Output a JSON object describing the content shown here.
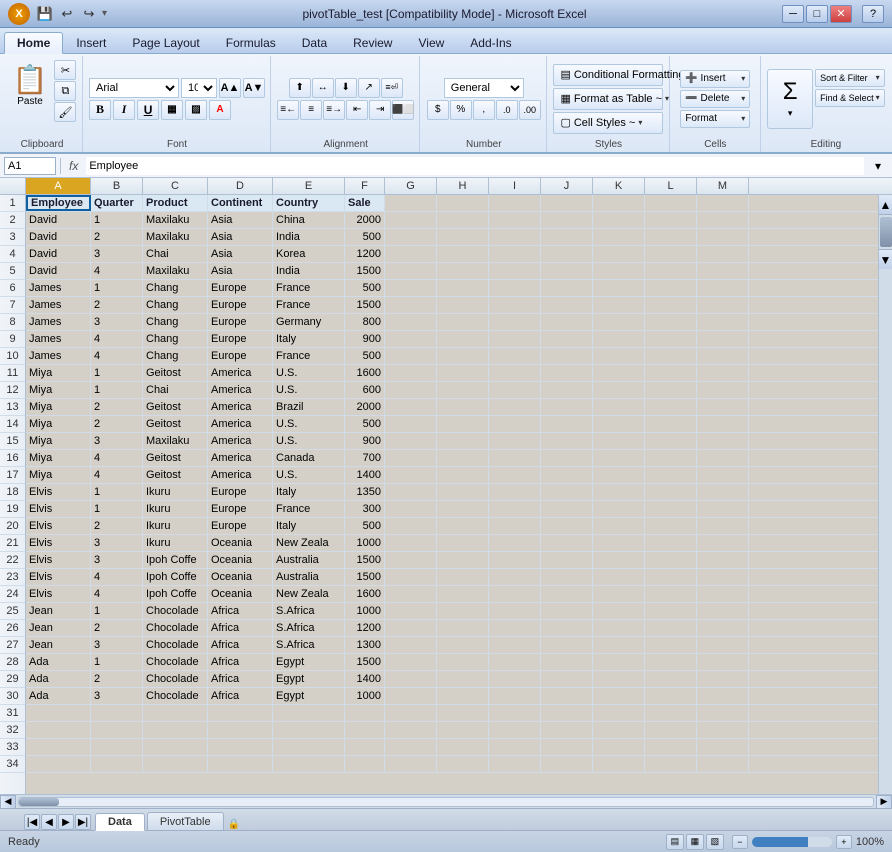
{
  "titleBar": {
    "title": "pivotTable_test [Compatibility Mode] - Microsoft Excel",
    "quickAccess": [
      "💾",
      "↩",
      "↪"
    ],
    "windowControls": [
      "─",
      "□",
      "✕"
    ]
  },
  "ribbon": {
    "tabs": [
      "Home",
      "Insert",
      "Page Layout",
      "Formulas",
      "Data",
      "Review",
      "View",
      "Add-Ins"
    ],
    "activeTab": "Home",
    "groups": {
      "clipboard": {
        "label": "Clipboard",
        "paste": "Paste"
      },
      "font": {
        "label": "Font",
        "name": "Arial",
        "size": "10"
      },
      "alignment": {
        "label": "Alignment"
      },
      "number": {
        "label": "Number",
        "format": "General"
      },
      "styles": {
        "label": "Styles",
        "condFormat": "Conditional Formatting ~",
        "formatTable": "Format as Table ~",
        "cellStyles": "Cell Styles ~"
      },
      "cells": {
        "label": "Cells",
        "insert": "Insert",
        "delete": "Delete",
        "format": "Format"
      },
      "editing": {
        "label": "Editing",
        "sum": "Σ",
        "sortFilter": "Sort & Filter ~",
        "findSelect": "Find & Select ~"
      }
    }
  },
  "formulaBar": {
    "cellRef": "A1",
    "fx": "fx",
    "formula": "Employee"
  },
  "columns": [
    {
      "name": "A",
      "width": 65
    },
    {
      "name": "B",
      "width": 52
    },
    {
      "name": "C",
      "width": 65
    },
    {
      "name": "D",
      "width": 65
    },
    {
      "name": "E",
      "width": 72
    },
    {
      "name": "F",
      "width": 40
    },
    {
      "name": "G",
      "width": 52
    },
    {
      "name": "H",
      "width": 52
    },
    {
      "name": "I",
      "width": 52
    },
    {
      "name": "J",
      "width": 52
    },
    {
      "name": "K",
      "width": 52
    },
    {
      "name": "L",
      "width": 52
    },
    {
      "name": "M",
      "width": 52
    }
  ],
  "rows": [
    [
      1,
      "Employee",
      "Quarter",
      "Product",
      "Continent",
      "Country",
      "Sale",
      "",
      "",
      "",
      "",
      "",
      "",
      ""
    ],
    [
      2,
      "David",
      "1",
      "Maxilaku",
      "Asia",
      "China",
      "2000",
      "",
      "",
      "",
      "",
      "",
      "",
      ""
    ],
    [
      3,
      "David",
      "2",
      "Maxilaku",
      "Asia",
      "India",
      "500",
      "",
      "",
      "",
      "",
      "",
      "",
      ""
    ],
    [
      4,
      "David",
      "3",
      "Chai",
      "Asia",
      "Korea",
      "1200",
      "",
      "",
      "",
      "",
      "",
      "",
      ""
    ],
    [
      5,
      "David",
      "4",
      "Maxilaku",
      "Asia",
      "India",
      "1500",
      "",
      "",
      "",
      "",
      "",
      "",
      ""
    ],
    [
      6,
      "James",
      "1",
      "Chang",
      "Europe",
      "France",
      "500",
      "",
      "",
      "",
      "",
      "",
      "",
      ""
    ],
    [
      7,
      "James",
      "2",
      "Chang",
      "Europe",
      "France",
      "1500",
      "",
      "",
      "",
      "",
      "",
      "",
      ""
    ],
    [
      8,
      "James",
      "3",
      "Chang",
      "Europe",
      "Germany",
      "800",
      "",
      "",
      "",
      "",
      "",
      "",
      ""
    ],
    [
      9,
      "James",
      "4",
      "Chang",
      "Europe",
      "Italy",
      "900",
      "",
      "",
      "",
      "",
      "",
      "",
      ""
    ],
    [
      10,
      "James",
      "4",
      "Chang",
      "Europe",
      "France",
      "500",
      "",
      "",
      "",
      "",
      "",
      "",
      ""
    ],
    [
      11,
      "Miya",
      "1",
      "Geitost",
      "America",
      "U.S.",
      "1600",
      "",
      "",
      "",
      "",
      "",
      "",
      ""
    ],
    [
      12,
      "Miya",
      "1",
      "Chai",
      "America",
      "U.S.",
      "600",
      "",
      "",
      "",
      "",
      "",
      "",
      ""
    ],
    [
      13,
      "Miya",
      "2",
      "Geitost",
      "America",
      "Brazil",
      "2000",
      "",
      "",
      "",
      "",
      "",
      "",
      ""
    ],
    [
      14,
      "Miya",
      "2",
      "Geitost",
      "America",
      "U.S.",
      "500",
      "",
      "",
      "",
      "",
      "",
      "",
      ""
    ],
    [
      15,
      "Miya",
      "3",
      "Maxilaku",
      "America",
      "U.S.",
      "900",
      "",
      "",
      "",
      "",
      "",
      "",
      ""
    ],
    [
      16,
      "Miya",
      "4",
      "Geitost",
      "America",
      "Canada",
      "700",
      "",
      "",
      "",
      "",
      "",
      "",
      ""
    ],
    [
      17,
      "Miya",
      "4",
      "Geitost",
      "America",
      "U.S.",
      "1400",
      "",
      "",
      "",
      "",
      "",
      "",
      ""
    ],
    [
      18,
      "Elvis",
      "1",
      "Ikuru",
      "Europe",
      "Italy",
      "1350",
      "",
      "",
      "",
      "",
      "",
      "",
      ""
    ],
    [
      19,
      "Elvis",
      "1",
      "Ikuru",
      "Europe",
      "France",
      "300",
      "",
      "",
      "",
      "",
      "",
      "",
      ""
    ],
    [
      20,
      "Elvis",
      "2",
      "Ikuru",
      "Europe",
      "Italy",
      "500",
      "",
      "",
      "",
      "",
      "",
      "",
      ""
    ],
    [
      21,
      "Elvis",
      "3",
      "Ikuru",
      "Oceania",
      "New Zeala",
      "1000",
      "",
      "",
      "",
      "",
      "",
      "",
      ""
    ],
    [
      22,
      "Elvis",
      "3",
      "Ipoh Coffe",
      "Oceania",
      "Australia",
      "1500",
      "",
      "",
      "",
      "",
      "",
      "",
      ""
    ],
    [
      23,
      "Elvis",
      "4",
      "Ipoh Coffe",
      "Oceania",
      "Australia",
      "1500",
      "",
      "",
      "",
      "",
      "",
      "",
      ""
    ],
    [
      24,
      "Elvis",
      "4",
      "Ipoh Coffe",
      "Oceania",
      "New Zeala",
      "1600",
      "",
      "",
      "",
      "",
      "",
      "",
      ""
    ],
    [
      25,
      "Jean",
      "1",
      "Chocolade",
      "Africa",
      "S.Africa",
      "1000",
      "",
      "",
      "",
      "",
      "",
      "",
      ""
    ],
    [
      26,
      "Jean",
      "2",
      "Chocolade",
      "Africa",
      "S.Africa",
      "1200",
      "",
      "",
      "",
      "",
      "",
      "",
      ""
    ],
    [
      27,
      "Jean",
      "3",
      "Chocolade",
      "Africa",
      "S.Africa",
      "1300",
      "",
      "",
      "",
      "",
      "",
      "",
      ""
    ],
    [
      28,
      "Ada",
      "1",
      "Chocolade",
      "Africa",
      "Egypt",
      "1500",
      "",
      "",
      "",
      "",
      "",
      "",
      ""
    ],
    [
      29,
      "Ada",
      "2",
      "Chocolade",
      "Africa",
      "Egypt",
      "1400",
      "",
      "",
      "",
      "",
      "",
      "",
      ""
    ],
    [
      30,
      "Ada",
      "3",
      "Chocolade",
      "Africa",
      "Egypt",
      "1000",
      "",
      "",
      "",
      "",
      "",
      "",
      ""
    ],
    [
      31,
      "",
      "",
      "",
      "",
      "",
      "",
      "",
      "",
      "",
      "",
      "",
      "",
      ""
    ],
    [
      32,
      "",
      "",
      "",
      "",
      "",
      "",
      "",
      "",
      "",
      "",
      "",
      "",
      ""
    ],
    [
      33,
      "",
      "",
      "",
      "",
      "",
      "",
      "",
      "",
      "",
      "",
      "",
      "",
      ""
    ],
    [
      34,
      "",
      "",
      "",
      "",
      "",
      "",
      "",
      "",
      "",
      "",
      "",
      "",
      ""
    ]
  ],
  "sheets": [
    "Data",
    "PivotTable"
  ],
  "activeSheet": "Data",
  "statusBar": {
    "ready": "Ready",
    "zoom": "100%"
  },
  "colors": {
    "headerBg": "#dae8f4",
    "selectedCell": "#b8d8f0",
    "ribbonBg": "#dce7f6"
  }
}
